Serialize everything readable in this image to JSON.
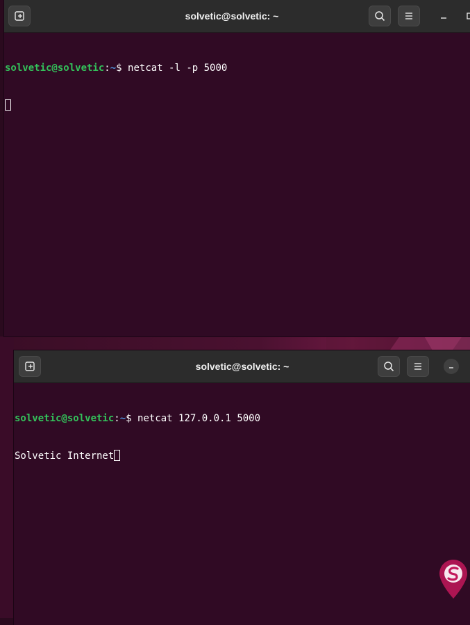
{
  "windows": [
    {
      "title": "solvetic@solvetic: ~",
      "prompt_user": "solvetic@solvetic",
      "prompt_sep": ":",
      "prompt_path": "~",
      "prompt_symbol": "$",
      "command": " netcat -l -p 5000",
      "output": ""
    },
    {
      "title": "solvetic@solvetic: ~",
      "prompt_user": "solvetic@solvetic",
      "prompt_sep": ":",
      "prompt_path": "~",
      "prompt_symbol": "$",
      "command": " netcat 127.0.0.1 5000",
      "output": "Solvetic Internet"
    }
  ],
  "icons": {
    "new_tab": "new-tab-icon",
    "search": "search-icon",
    "menu": "hamburger-menu-icon",
    "minimize": "minimize-icon",
    "maximize": "maximize-icon"
  },
  "colors": {
    "terminal_bg": "#300a24",
    "prompt_user": "#33c15a",
    "prompt_path": "#4f8fd6",
    "titlebar_bg": "#2c2c2c",
    "watermark": "#c2185b"
  }
}
